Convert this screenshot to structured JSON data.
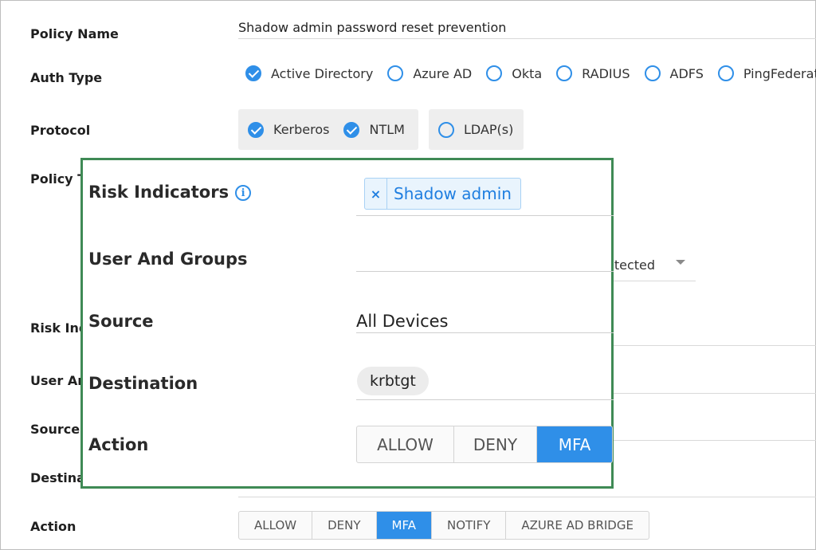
{
  "form": {
    "policy_name_label": "Policy Name",
    "policy_name_value": "Shadow admin password reset prevention",
    "auth_type_label": "Auth Type",
    "auth_types": [
      {
        "label": "Active Directory",
        "checked": true
      },
      {
        "label": "Azure AD",
        "checked": false
      },
      {
        "label": "Okta",
        "checked": false
      },
      {
        "label": "RADIUS",
        "checked": false
      },
      {
        "label": "ADFS",
        "checked": false
      },
      {
        "label": "PingFederate",
        "checked": false
      }
    ],
    "protocol_label": "Protocol",
    "protocols_group1": [
      {
        "label": "Kerberos",
        "checked": true
      },
      {
        "label": "NTLM",
        "checked": true
      }
    ],
    "protocols_group2": [
      {
        "label": "LDAP(s)",
        "checked": false
      }
    ],
    "policy_type_label_partial": "Policy T",
    "dropdown_partial_value": "etected",
    "risk_label_partial": "Risk Ind",
    "users_label_partial": "User An",
    "source_label": "Source",
    "destination_label_partial": "Destina",
    "action_label": "Action",
    "actions": [
      "ALLOW",
      "DENY",
      "MFA",
      "NOTIFY",
      "AZURE AD BRIDGE"
    ],
    "active_action": "MFA"
  },
  "zoom": {
    "risk_indicators_label": "Risk Indicators",
    "info_icon": "i",
    "risk_tag": "Shadow admin",
    "risk_tag_remove": "×",
    "users_groups_label": "User And Groups",
    "source_label": "Source",
    "source_value": "All Devices",
    "destination_label": "Destination",
    "destination_chip": "krbtgt",
    "action_label": "Action",
    "actions": [
      "ALLOW",
      "DENY",
      "MFA"
    ],
    "active_action": "MFA"
  },
  "colors": {
    "accent": "#2f8fe8",
    "zoom_border": "#3f8a55",
    "tag_text": "#1f7ee0"
  },
  "icons": {
    "checked": "check-circle-icon",
    "unchecked": "radio-empty-icon",
    "info": "info-icon",
    "remove": "close-icon",
    "dropdown": "caret-down-icon"
  }
}
